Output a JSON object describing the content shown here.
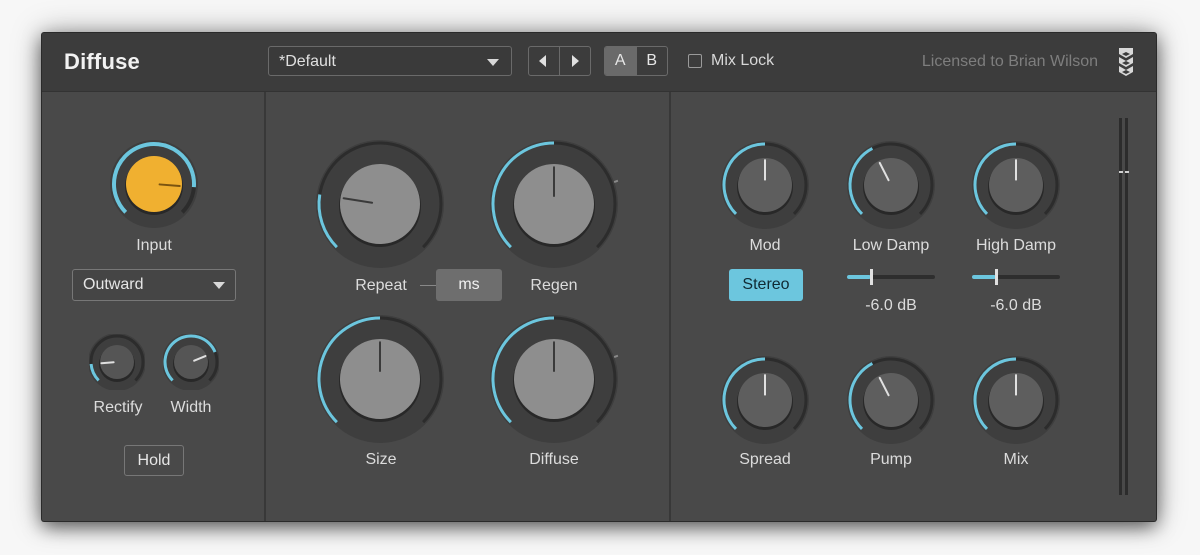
{
  "header": {
    "title": "Diffuse",
    "preset": "*Default",
    "ab": [
      "A",
      "B"
    ],
    "ab_active": "A",
    "mix_lock_label": "Mix Lock",
    "mix_lock_checked": false,
    "license": "Licensed to Brian Wilson"
  },
  "left": {
    "input_label": "Input",
    "mode": "Outward",
    "rectify_label": "Rectify",
    "width_label": "Width",
    "hold_label": "Hold"
  },
  "middle": {
    "repeat_label": "Repeat",
    "ms_label": "ms",
    "regen_label": "Regen",
    "size_label": "Size",
    "diffuse_label": "Diffuse"
  },
  "right": {
    "mod_label": "Mod",
    "stereo_label": "Stereo",
    "low_damp_label": "Low Damp",
    "low_damp_value": "-6.0 dB",
    "high_damp_label": "High Damp",
    "high_damp_value": "-6.0 dB",
    "spread_label": "Spread",
    "pump_label": "Pump",
    "mix_label": "Mix"
  },
  "knobs": {
    "input": 0.85,
    "rectify": 0.15,
    "width": 0.75,
    "repeat": 0.2,
    "regen": 0.5,
    "size": 0.5,
    "diffuse": 0.5,
    "mod": 0.5,
    "low_damp": 0.4,
    "high_damp": 0.5,
    "spread": 0.5,
    "pump": 0.4,
    "mix": 0.5
  },
  "sliders": {
    "low_damp": 0.27,
    "high_damp": 0.27
  },
  "colors": {
    "accent": "#6cc6de",
    "input_knob": "#f0b030",
    "panel": "#494949",
    "topbar": "#3c3c3c"
  }
}
